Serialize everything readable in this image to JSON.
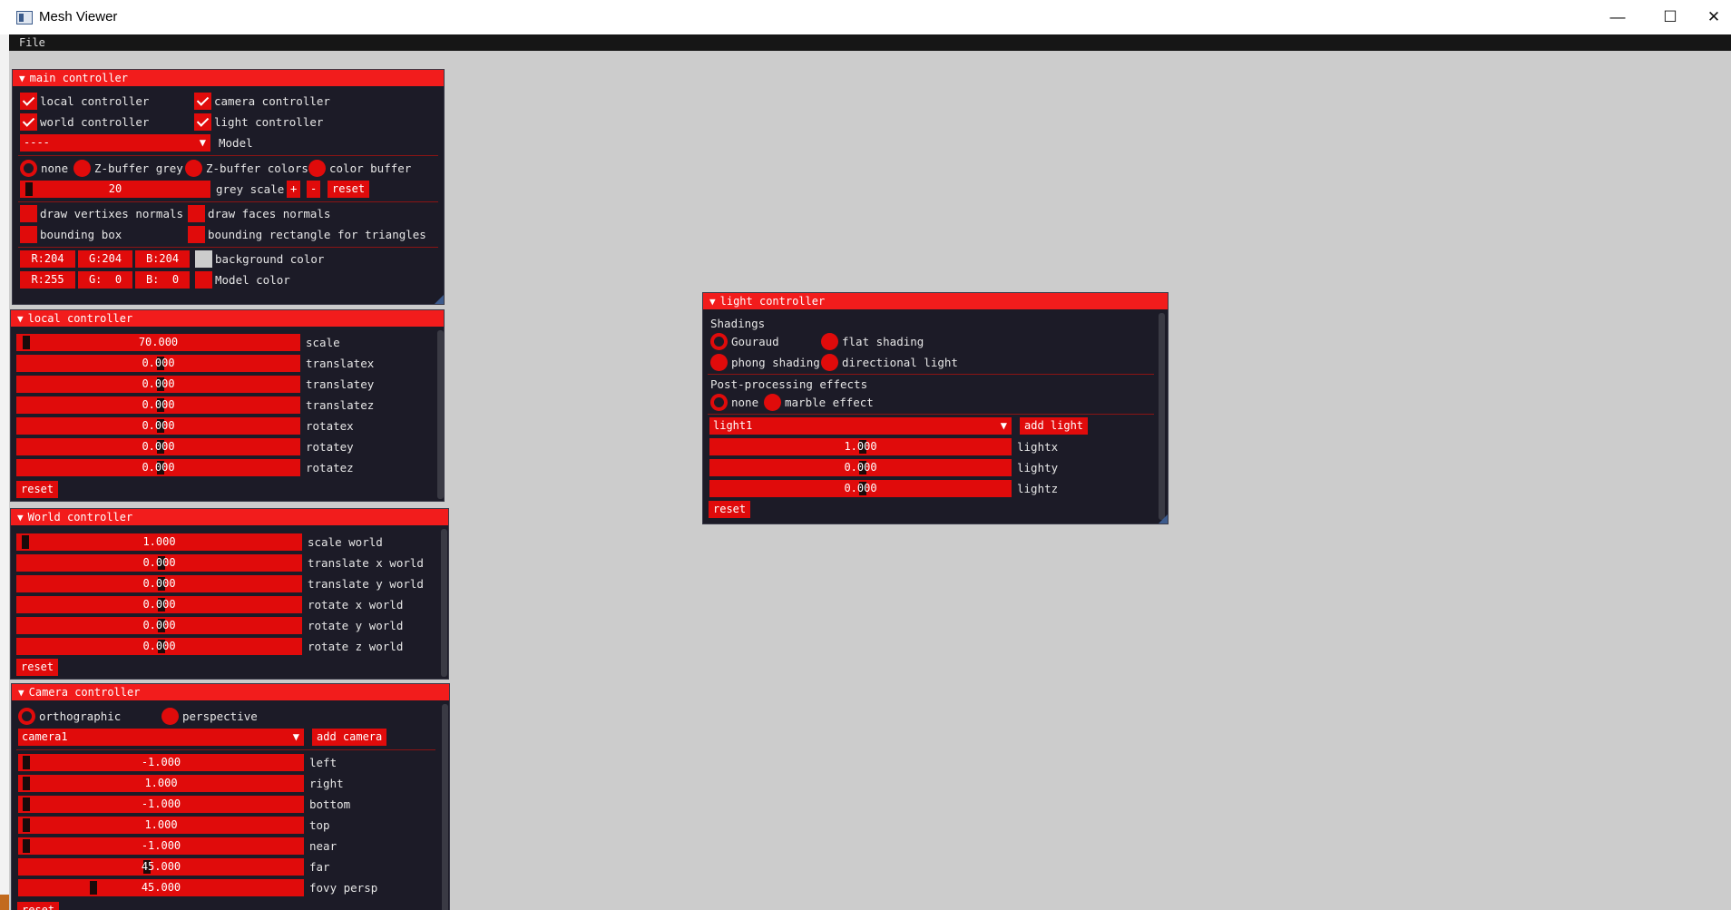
{
  "window": {
    "title": "Mesh Viewer",
    "minimize": "—",
    "maximize": "☐",
    "close": "✕"
  },
  "menu": {
    "file": "File"
  },
  "arrow": "▼",
  "main_controller": {
    "title": "main controller",
    "checks": [
      {
        "label": "local controller",
        "checked": true
      },
      {
        "label": "camera controller",
        "checked": true
      },
      {
        "label": "world controller",
        "checked": true
      },
      {
        "label": "light controller",
        "checked": true
      }
    ],
    "model_combo": {
      "value": "----",
      "label": "Model"
    },
    "buffer_radios": [
      {
        "label": "none",
        "selected": true
      },
      {
        "label": "Z-buffer grey",
        "selected": false
      },
      {
        "label": "Z-buffer colors",
        "selected": false
      },
      {
        "label": "color buffer",
        "selected": false
      }
    ],
    "grey_scale": {
      "value": "20",
      "label": "grey scale",
      "plus": "+",
      "minus": "-",
      "reset": "reset"
    },
    "draw_checks": [
      {
        "label": "draw vertixes normals",
        "checked": false
      },
      {
        "label": "draw faces normals",
        "checked": false
      },
      {
        "label": "bounding box",
        "checked": false
      },
      {
        "label": "bounding rectangle for triangles",
        "checked": false
      }
    ],
    "background_color": {
      "r": "R:204",
      "g": "G:204",
      "b": "B:204",
      "label": "background color",
      "swatch": "#cccccc"
    },
    "model_color": {
      "r": "R:255",
      "g": "G:  0",
      "b": "B:  0",
      "label": "Model color",
      "swatch": "#e00b0b"
    }
  },
  "local_controller": {
    "title": "local controller",
    "sliders": [
      {
        "value": "70.000",
        "label": "scale"
      },
      {
        "value": "0.000",
        "label": "translatex"
      },
      {
        "value": "0.000",
        "label": "translatey"
      },
      {
        "value": "0.000",
        "label": "translatez"
      },
      {
        "value": "0.000",
        "label": "rotatex"
      },
      {
        "value": "0.000",
        "label": "rotatey"
      },
      {
        "value": "0.000",
        "label": "rotatez"
      }
    ],
    "reset": "reset"
  },
  "world_controller": {
    "title": "World controller",
    "sliders": [
      {
        "value": "1.000",
        "label": "scale world"
      },
      {
        "value": "0.000",
        "label": "translate x world"
      },
      {
        "value": "0.000",
        "label": "translate y world"
      },
      {
        "value": "0.000",
        "label": "rotate x world"
      },
      {
        "value": "0.000",
        "label": "rotate y world"
      },
      {
        "value": "0.000",
        "label": "rotate z world"
      }
    ],
    "reset": "reset"
  },
  "camera_controller": {
    "title": "Camera controller",
    "radios": [
      {
        "label": "orthographic",
        "selected": true
      },
      {
        "label": "perspective",
        "selected": false
      }
    ],
    "camera_combo": "camera1",
    "add_camera": "add camera",
    "sliders": [
      {
        "value": "-1.000",
        "label": "left"
      },
      {
        "value": "1.000",
        "label": "right"
      },
      {
        "value": "-1.000",
        "label": "bottom"
      },
      {
        "value": "1.000",
        "label": "top"
      },
      {
        "value": "-1.000",
        "label": "near"
      },
      {
        "value": "45.000",
        "label": "far"
      },
      {
        "value": "45.000",
        "label": "fovy persp"
      }
    ],
    "reset": "reset"
  },
  "light_controller": {
    "title": "light controller",
    "shadings_label": "Shadings",
    "shading_radios": [
      {
        "label": "Gouraud",
        "selected": true
      },
      {
        "label": "flat shading",
        "selected": false
      },
      {
        "label": "phong shading",
        "selected": false
      },
      {
        "label": "directional light",
        "selected": false
      }
    ],
    "post_label": "Post-processing effects",
    "post_radios": [
      {
        "label": "none",
        "selected": true
      },
      {
        "label": "marble effect",
        "selected": false
      }
    ],
    "light_combo": "light1",
    "add_light": "add light",
    "sliders": [
      {
        "value": "1.000",
        "label": "lightx"
      },
      {
        "value": "0.000",
        "label": "lighty"
      },
      {
        "value": "0.000",
        "label": "lightz"
      }
    ],
    "reset": "reset"
  }
}
